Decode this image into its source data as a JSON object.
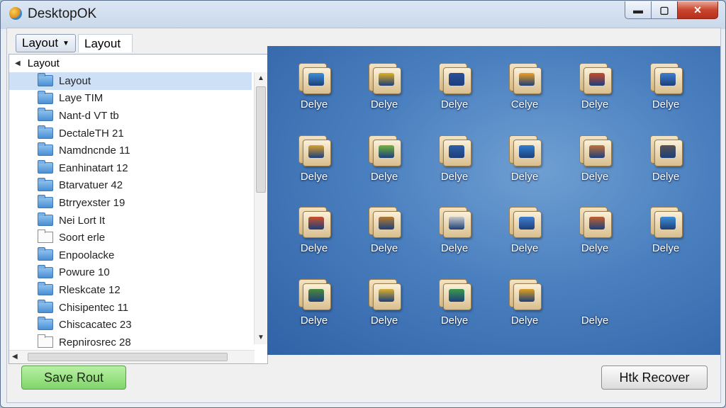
{
  "window": {
    "title": "DesktopOK",
    "min_label": "▬",
    "max_label": "▢",
    "close_label": "✕"
  },
  "tabs": {
    "dropdown_label": "Layout",
    "plain_label": "Layout"
  },
  "tree": {
    "header": "Layout",
    "rows": [
      {
        "label": "Layout",
        "icon": "folder-icon"
      },
      {
        "label": "Laye TIM",
        "icon": "folder-icon"
      },
      {
        "label": "Nant-d VT tb",
        "icon": "folder-icon"
      },
      {
        "label": "DectaleTH 21",
        "icon": "folder-icon"
      },
      {
        "label": "Namdncnde 11",
        "icon": "folder-icon"
      },
      {
        "label": "Eanhinatart 12",
        "icon": "folder-icon"
      },
      {
        "label": "Btarvatuer 42",
        "icon": "folder-icon"
      },
      {
        "label": "Btrryexster 19",
        "icon": "folder-icon"
      },
      {
        "label": "Nei Lort It",
        "icon": "folder-icon"
      },
      {
        "label": "Soort erle",
        "icon": "document-icon"
      },
      {
        "label": "Enpoolacke",
        "icon": "folder-icon"
      },
      {
        "label": "Powure 10",
        "icon": "folder-icon"
      },
      {
        "label": "Rleskcate 12",
        "icon": "folder-icon"
      },
      {
        "label": "Chisipentec 11",
        "icon": "folder-icon"
      },
      {
        "label": "Chiscacatec 23",
        "icon": "folder-icon"
      },
      {
        "label": "Repnirosrec 28",
        "icon": "document-icon"
      }
    ]
  },
  "desktop": {
    "icons": [
      {
        "label": "Delye",
        "badge": "#3f8fd8"
      },
      {
        "label": "Delye",
        "badge": "#e0b020"
      },
      {
        "label": "Delye",
        "badge": "#2d4f9a"
      },
      {
        "label": "Celye",
        "badge": "#f0a020"
      },
      {
        "label": "Delye",
        "badge": "#c94a2a"
      },
      {
        "label": "Delye",
        "badge": "#3f7fd0"
      },
      {
        "label": "Delye",
        "badge": "#d9a030"
      },
      {
        "label": "Delye",
        "badge": "#6fb43a"
      },
      {
        "label": "Delye",
        "badge": "#2d5fa8"
      },
      {
        "label": "Delye",
        "badge": "#2f7fd0"
      },
      {
        "label": "Delye",
        "badge": "#c0703a"
      },
      {
        "label": "Delye",
        "badge": "#555555"
      },
      {
        "label": "Delye",
        "badge": "#c9502a"
      },
      {
        "label": "Delye",
        "badge": "#b37a30"
      },
      {
        "label": "Delye",
        "badge": "#c8c8c8"
      },
      {
        "label": "Delye",
        "badge": "#3f7fd0"
      },
      {
        "label": "Delye",
        "badge": "#c06030"
      },
      {
        "label": "Delye",
        "badge": "#3f8fd8"
      },
      {
        "label": "Delye",
        "badge": "#4a8a3a"
      },
      {
        "label": "Delye",
        "badge": "#d9b030"
      },
      {
        "label": "Delye",
        "badge": "#3a9a4a"
      },
      {
        "label": "Delye",
        "badge": "#e0a020"
      },
      {
        "label": "Delye",
        "badge": ""
      }
    ]
  },
  "buttons": {
    "save_label": "Save Rout",
    "recover_label": "Htk Recover"
  },
  "colors": {
    "accent": "#4a7fbf",
    "selection": "#cde0f6",
    "save_green": "#7fd56a"
  }
}
